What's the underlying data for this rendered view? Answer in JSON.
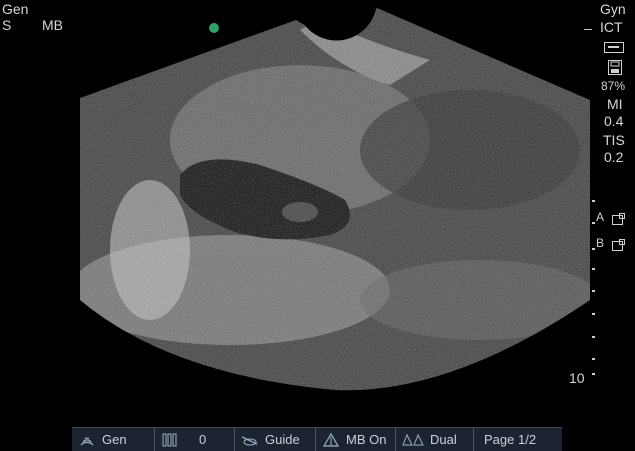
{
  "top_left": {
    "line1": "Gen",
    "line2_left": "S",
    "line2_right": "MB"
  },
  "top_right": {
    "preset": "Gyn",
    "probe": "ICT",
    "probe_dash": "–"
  },
  "side": {
    "percent": "87%",
    "mi_label": "MI",
    "mi_value": "0.4",
    "tis_label": "TIS",
    "tis_value": "0.2",
    "marker_a": "A",
    "marker_b": "B",
    "depth": "10"
  },
  "bottom_bar": {
    "gen_label": "Gen",
    "count_label": "0",
    "guide_label": "Guide",
    "mb_label": "MB On",
    "dual_label": "Dual",
    "page_label": "Page 1/2"
  },
  "colors": {
    "orientation_dot": "#2fa36b",
    "bar_bg": "#1b2430"
  },
  "icons": [
    "probe-icon",
    "storage-icon",
    "frame-icon",
    "gen-icon",
    "gain-icon",
    "guide-icon",
    "mb-icon",
    "dual-icon"
  ]
}
